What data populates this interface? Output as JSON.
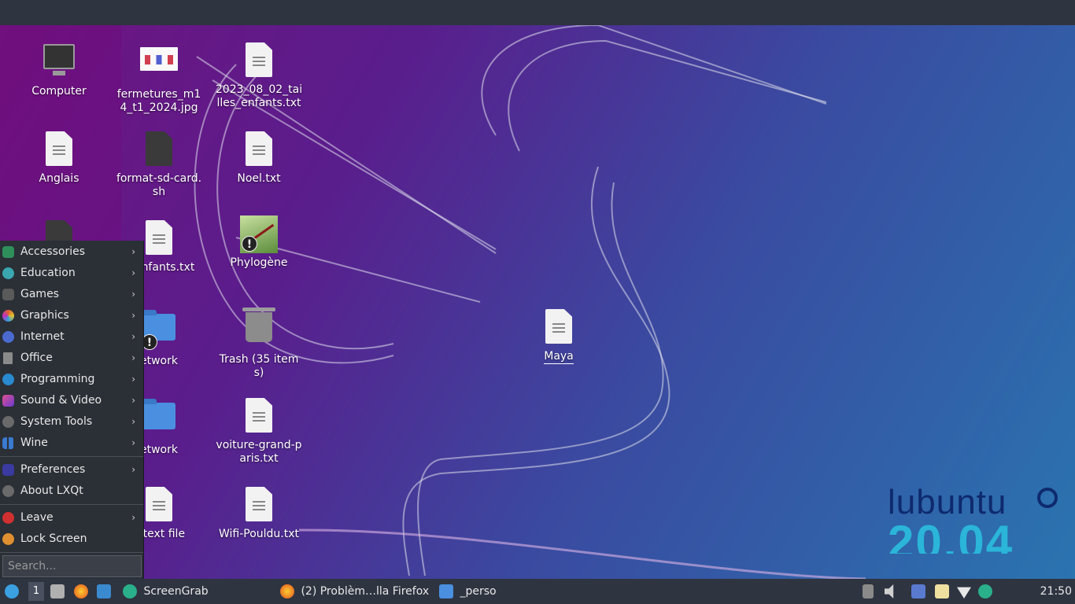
{
  "desktop_icons": {
    "computer": "Computer",
    "fermetures": "fermetures_m14_t1_2024.jpg",
    "tailles": "2023_08_02_tailles_enfants.txt",
    "anglais": "Anglais",
    "format_sd": "format-sd-card.sh",
    "noel": "Noel.txt",
    "enfants_partial": "s_enfants.txt",
    "phylogene": "Phylogène",
    "network1": "etwork",
    "trash": "Trash (35 items)",
    "maya": "Maya",
    "network2": "etwork",
    "voiture": "voiture-grand-paris.txt",
    "new_text": "v text file",
    "wifi": "Wifi-Pouldu.txt"
  },
  "menu": {
    "categories": [
      {
        "label": "Accessories",
        "icon": "accessories-icon",
        "color": "#2e8f5a"
      },
      {
        "label": "Education",
        "icon": "education-icon",
        "color": "#3aa7b0"
      },
      {
        "label": "Games",
        "icon": "games-icon",
        "color": "#5a5a5a"
      },
      {
        "label": "Graphics",
        "icon": "graphics-icon",
        "color": "#e06030"
      },
      {
        "label": "Internet",
        "icon": "internet-icon",
        "color": "#4a6ad0"
      },
      {
        "label": "Office",
        "icon": "office-icon",
        "color": "#8a8a8a"
      },
      {
        "label": "Programming",
        "icon": "programming-icon",
        "color": "#2a8ad0"
      },
      {
        "label": "Sound & Video",
        "icon": "sound-video-icon",
        "color": "#9a3ac0"
      },
      {
        "label": "System Tools",
        "icon": "system-tools-icon",
        "color": "#6a6a6a"
      },
      {
        "label": "Wine",
        "icon": "wine-icon",
        "color": "#3a7ad0"
      }
    ],
    "preferences": "Preferences",
    "about": "About LXQt",
    "leave": "Leave",
    "lock": "Lock Screen",
    "search_placeholder": "Search..."
  },
  "logo": {
    "word": "lubuntu",
    "version": "20.04"
  },
  "taskbar": {
    "desktop_number": "1",
    "screengrab": "ScreenGrab",
    "firefox": "(2) Problèm…lla Firefox",
    "perso": "_perso",
    "clock": "21:50"
  }
}
